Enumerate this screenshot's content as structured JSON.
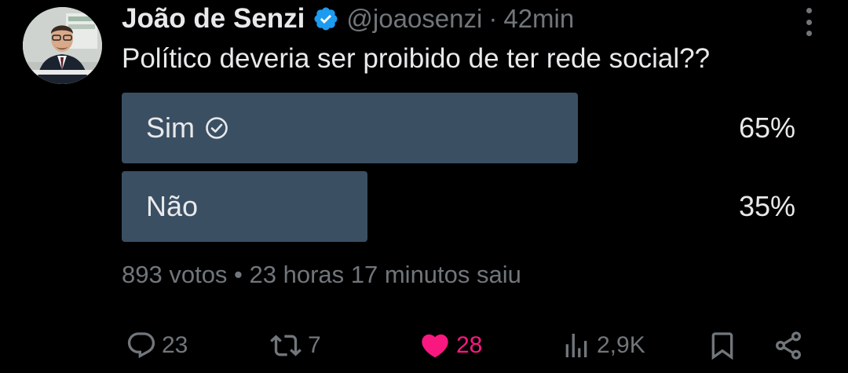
{
  "tweet": {
    "author_name": "João de Senzi",
    "handle": "@joaosenzi",
    "separator": "·",
    "time": "42min",
    "text": "Político deveria ser proibido de ter rede social??",
    "verified": true
  },
  "poll": {
    "options": [
      {
        "label": "Sim",
        "percent_text": "65%",
        "percent": 65,
        "winner": true
      },
      {
        "label": "Não",
        "percent_text": "35%",
        "percent": 35,
        "winner": false
      }
    ],
    "meta": "893 votos • 23 horas 17 minutos saiu"
  },
  "actions": {
    "replies": "23",
    "retweets": "7",
    "likes": "28",
    "views": "2,9K"
  },
  "colors": {
    "background": "#000000",
    "text": "#e7e9ea",
    "muted": "#71767b",
    "poll_bar": "#3b4f63",
    "verified": "#1d9bf0",
    "like": "#f91880"
  },
  "icons": {
    "verified": "verified-badge-icon",
    "more": "more-options-icon",
    "winner": "check-circle-icon",
    "reply": "reply-icon",
    "retweet": "retweet-icon",
    "like": "heart-icon",
    "views": "views-icon",
    "bookmark": "bookmark-icon",
    "share": "share-icon"
  }
}
